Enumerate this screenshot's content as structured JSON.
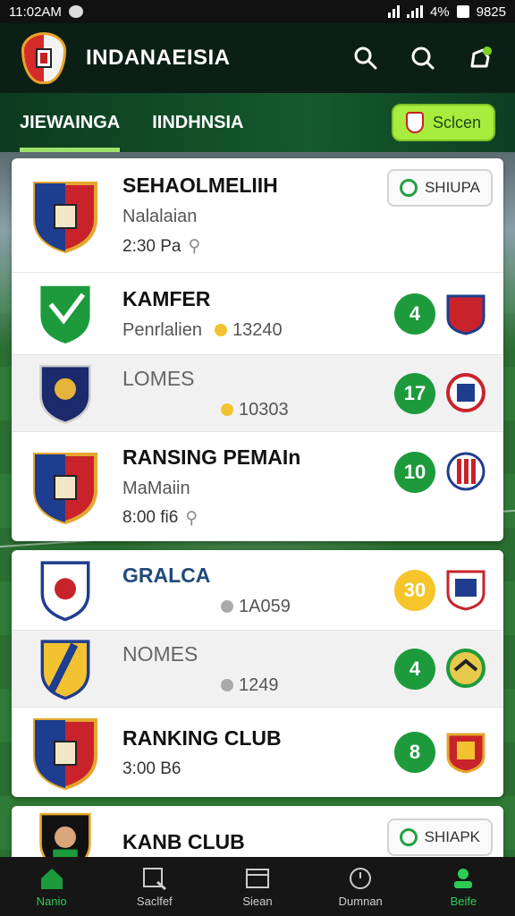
{
  "status": {
    "time": "11:02AM",
    "battery": "4%",
    "clock": "9825"
  },
  "app": {
    "title": "INDANAEISIA"
  },
  "tabs": [
    {
      "label": "JIEWAINGA",
      "active": true
    },
    {
      "label": "IINDHNSIA",
      "active": false
    }
  ],
  "select_button": {
    "label": "Sclcen"
  },
  "groups": [
    {
      "rows": [
        {
          "name": "SEHAOLMELIIH",
          "sub": "Nalalaian",
          "meta": "2:30 Pa",
          "pill": "SHIUPA"
        },
        {
          "name": "KAMFER",
          "sub": "Penrlalien",
          "coins": "13240",
          "score": "4"
        },
        {
          "name": "LOMES",
          "coins": "10303",
          "score": "17"
        },
        {
          "name": "RANSING PEMAIn",
          "sub": "MaMaiin",
          "meta": "8:00 fi6",
          "score": "10"
        }
      ]
    },
    {
      "rows": [
        {
          "name": "GRALCA",
          "coins": "1A059",
          "score": "30"
        },
        {
          "name": "NOMES",
          "coins": "1249",
          "score": "4"
        },
        {
          "name": "RANKING CLUB",
          "meta": "3:00 B6",
          "score": "8"
        }
      ]
    },
    {
      "rows": [
        {
          "name": "KANB CLUB",
          "pill": "SHIAPK"
        }
      ]
    }
  ],
  "nav": [
    {
      "label": "Nanio",
      "icon": "home-icon",
      "active": true
    },
    {
      "label": "Saclfef",
      "icon": "search-icon",
      "active": false
    },
    {
      "label": "Siean",
      "icon": "box-icon",
      "active": false
    },
    {
      "label": "Dumnan",
      "icon": "clock-icon",
      "active": false
    },
    {
      "label": "Beife",
      "icon": "profile-icon",
      "active": true
    }
  ],
  "colors": {
    "accent": "#1d9b3c",
    "header": "#0c1f14",
    "select": "#a8ec3d",
    "gold": "#f5c52a"
  }
}
